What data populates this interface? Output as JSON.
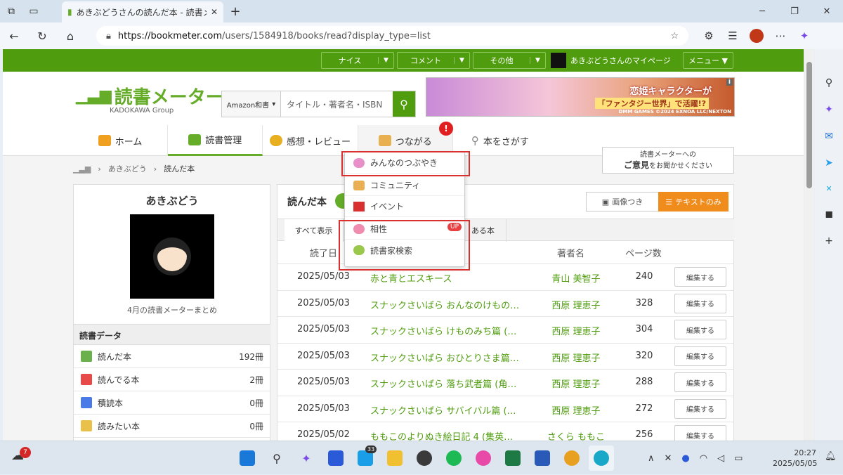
{
  "browser": {
    "tab_title": "あきぶどうさんの読んだ本 - 読書メーター",
    "url_host": "https://bookmeter.com",
    "url_path": "/users/1584918/books/read?display_type=list"
  },
  "greenbar": {
    "nice": "ナイス",
    "comment": "コメント",
    "other": "その他",
    "mypage": "あきぶどうさんのマイページ",
    "menu": "メニュー ▼"
  },
  "header": {
    "logo": "読書メーター",
    "logo_sub": "KADOKAWA Group",
    "search_select": "Amazon和書",
    "search_placeholder": "タイトル・著者名・ISBN",
    "banner_line1": "恋姫キャラクターが",
    "banner_line2": "「ファンタジー世界」で活躍!?",
    "banner_line3": "DMM GAMES ©2024 EXNOA LLC/NEXTON",
    "opinion_line1": "読書メーターへの",
    "opinion_bold": "ご意見",
    "opinion_line2": "をお聞かせください"
  },
  "nav": [
    "ホーム",
    "読書管理",
    "感想・レビュー",
    "つながる",
    "本をさがす"
  ],
  "nav_badge": "!",
  "breadcrumb": [
    "あきぶどう",
    "読んだ本"
  ],
  "profile": {
    "name": "あきぶどう",
    "summary": "4月の読書メーターまとめ",
    "data_heading": "読書データ",
    "rows": [
      {
        "label": "読んだ本",
        "count": "192冊",
        "color": "#6ab04c"
      },
      {
        "label": "読んでる本",
        "count": "2冊",
        "color": "#e84a4a"
      },
      {
        "label": "積読本",
        "count": "0冊",
        "color": "#4a7ae8"
      },
      {
        "label": "読みたい本",
        "count": "0冊",
        "color": "#e8c04a"
      }
    ]
  },
  "list": {
    "title": "読んだ本",
    "view_image": "画像つき",
    "view_text": "テキストのみ",
    "tab_all": "すべて表示",
    "tab_2": "ある本",
    "col_date": "読了日",
    "col_author": "著者名",
    "col_pages": "ページ数",
    "edit": "編集する",
    "rows": [
      {
        "date": "2025/05/03",
        "title": "赤と青とエスキース",
        "author": "青山 美智子",
        "pages": "240"
      },
      {
        "date": "2025/05/03",
        "title": "スナックさいばら おんなのけもの…",
        "author": "西原 理恵子",
        "pages": "328"
      },
      {
        "date": "2025/05/03",
        "title": "スナックさいばら けものみち篇 (…",
        "author": "西原 理恵子",
        "pages": "304"
      },
      {
        "date": "2025/05/03",
        "title": "スナックさいばら おひとりさま篇…",
        "author": "西原 理恵子",
        "pages": "320"
      },
      {
        "date": "2025/05/03",
        "title": "スナックさいばら 落ち武者篇 (角…",
        "author": "西原 理恵子",
        "pages": "288"
      },
      {
        "date": "2025/05/03",
        "title": "スナックさいばら サバイバル篇 (…",
        "author": "西原 理恵子",
        "pages": "272"
      },
      {
        "date": "2025/05/02",
        "title": "ももこのよりぬき絵日記 4 (集英…",
        "author": "さくら ももこ",
        "pages": "256"
      }
    ]
  },
  "dropdown": {
    "items": [
      "みんなのつぶやき",
      "コミュニティ",
      "イベント",
      "相性",
      "読書家検索"
    ],
    "up": "UP"
  },
  "taskbar": {
    "weather_badge": "7",
    "app_badge": "33",
    "time": "20:27",
    "date": "2025/05/05"
  }
}
